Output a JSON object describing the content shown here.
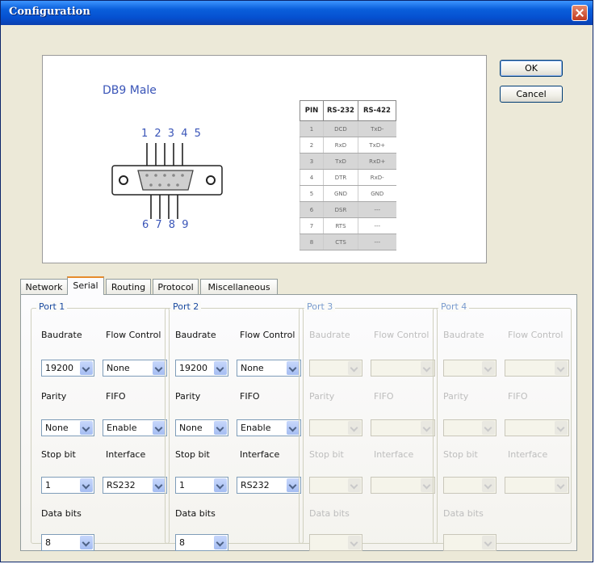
{
  "window": {
    "title": "Configuration"
  },
  "buttons": {
    "ok": "OK",
    "cancel": "Cancel"
  },
  "pinout": {
    "connector_label": "DB9 Male",
    "top_pins": "1 2 3 4 5",
    "bottom_pins": "6 7 8 9",
    "columns": [
      "PIN",
      "RS-232",
      "RS-422"
    ],
    "rows": [
      [
        "1",
        "DCD",
        "TxD-"
      ],
      [
        "2",
        "RxD",
        "TxD+"
      ],
      [
        "3",
        "TxD",
        "RxD+"
      ],
      [
        "4",
        "DTR",
        "RxD-"
      ],
      [
        "5",
        "GND",
        "GND"
      ],
      [
        "6",
        "DSR",
        "---"
      ],
      [
        "7",
        "RTS",
        "---"
      ],
      [
        "8",
        "CTS",
        "---"
      ]
    ]
  },
  "tabs": [
    "Network",
    "Serial",
    "Routing",
    "Protocol",
    "Miscellaneous"
  ],
  "active_tab": "Serial",
  "labels": {
    "baudrate": "Baudrate",
    "flow_control": "Flow Control",
    "parity": "Parity",
    "fifo": "FIFO",
    "stop_bit": "Stop bit",
    "interface": "Interface",
    "data_bits": "Data bits"
  },
  "ports": [
    {
      "title": "Port 1",
      "enabled": true,
      "baudrate": "19200",
      "flow_control": "None",
      "parity": "None",
      "fifo": "Enable",
      "stop_bit": "1",
      "interface": "RS232",
      "data_bits": "8"
    },
    {
      "title": "Port 2",
      "enabled": true,
      "baudrate": "19200",
      "flow_control": "None",
      "parity": "None",
      "fifo": "Enable",
      "stop_bit": "1",
      "interface": "RS232",
      "data_bits": "8"
    },
    {
      "title": "Port 3",
      "enabled": false,
      "baudrate": "",
      "flow_control": "",
      "parity": "",
      "fifo": "",
      "stop_bit": "",
      "interface": "",
      "data_bits": ""
    },
    {
      "title": "Port 4",
      "enabled": false,
      "baudrate": "",
      "flow_control": "",
      "parity": "",
      "fifo": "",
      "stop_bit": "",
      "interface": "",
      "data_bits": ""
    }
  ],
  "colors": {
    "titlebar": "#0550d0",
    "group_title": "#1a4aa0",
    "tab_highlight": "#e68b2c"
  }
}
